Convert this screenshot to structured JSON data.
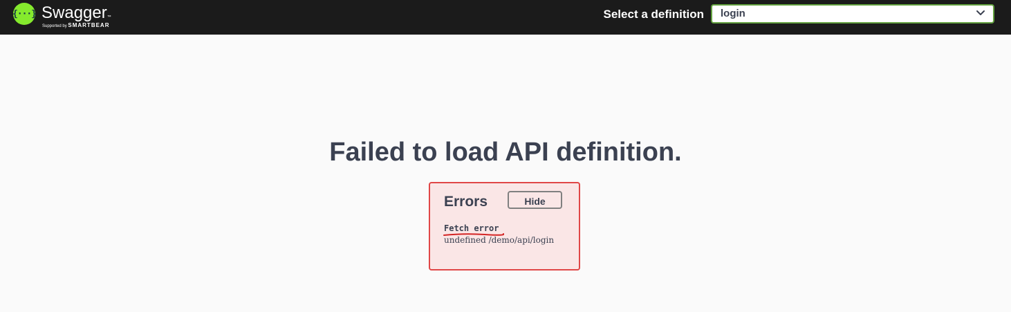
{
  "topbar": {
    "brand": {
      "name": "Swagger",
      "trademark": "™",
      "icon_glyph": "{···}",
      "supported_by": "Supported by",
      "company": "SMARTBEAR"
    },
    "definition_label": "Select a definition",
    "definition_select": {
      "value": "login",
      "icon": "chevron-down-icon"
    }
  },
  "main": {
    "headline": "Failed to load API definition."
  },
  "errors": {
    "title": "Errors",
    "hide_label": "Hide",
    "items": [
      {
        "title": "Fetch error",
        "message": "undefined /demo/api/login"
      }
    ]
  },
  "colors": {
    "topbar_bg": "#1b1b1b",
    "brand_green": "#85ea2d",
    "select_border": "#62a03f",
    "error_border": "#e04646",
    "error_bg": "#fae6e6",
    "text_dark": "#3b4151",
    "annotation_red": "#d32424"
  }
}
